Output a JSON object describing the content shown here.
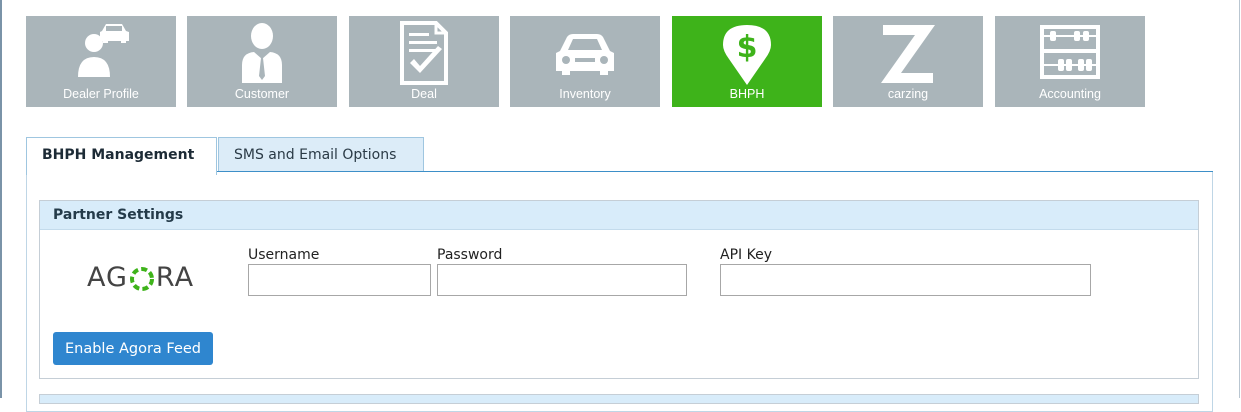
{
  "nav_tiles": [
    {
      "label": "Dealer Profile",
      "icon": "dealer-profile-icon"
    },
    {
      "label": "Customer",
      "icon": "customer-icon"
    },
    {
      "label": "Deal",
      "icon": "deal-document-icon"
    },
    {
      "label": "Inventory",
      "icon": "car-icon"
    },
    {
      "label": "BHPH",
      "icon": "dollar-pin-icon",
      "active": true
    },
    {
      "label": "carzing",
      "icon": "carzing-z-icon"
    },
    {
      "label": "Accounting",
      "icon": "abacus-icon"
    }
  ],
  "colors": {
    "tile_bg": "#aab5ba",
    "tile_active_bg": "#3eb31a",
    "tab_accent": "#3d8fc8",
    "section_header_bg": "#d8ecfa",
    "button_bg": "#2f86cf",
    "logo_green": "#3eb31a"
  },
  "tabs": [
    {
      "label": "BHPH Management",
      "active": true
    },
    {
      "label": "SMS and Email Options",
      "active": false
    }
  ],
  "partner_settings": {
    "title": "Partner Settings",
    "partner_logo_text": "AGORA",
    "fields": {
      "username": {
        "label": "Username",
        "value": ""
      },
      "password": {
        "label": "Password",
        "value": ""
      },
      "api_key": {
        "label": "API Key",
        "value": ""
      }
    },
    "enable_button": "Enable Agora Feed"
  }
}
